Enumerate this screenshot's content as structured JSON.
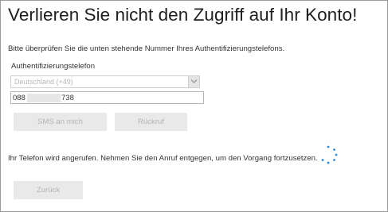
{
  "header": {
    "title": "Verlieren Sie nicht den Zugriff auf Ihr Konto!"
  },
  "form": {
    "instruction": "Bitte überprüfen Sie die unten stehende Nummer Ihres Authentifizierungstelefons.",
    "phone_label": "Authentifizierungstelefon",
    "country_value": "Deutschland (+49)",
    "phone_value_start": "088",
    "phone_value_end": "738"
  },
  "buttons": {
    "sms_label": "SMS an mich",
    "callback_label": "Rückruf",
    "back_label": "Zurück"
  },
  "status": {
    "message": "Ihr Telefon wird angerufen. Nehmen Sie den Anruf entgegen, um den Vorgang fortzusetzen."
  },
  "colors": {
    "spinner": "#2b88d8",
    "disabled_button_bg": "#e9e9e9",
    "disabled_text": "#b5b5b5"
  },
  "icons": {
    "dropdown": "chevron-down-icon",
    "loading": "loading-spinner-icon"
  }
}
